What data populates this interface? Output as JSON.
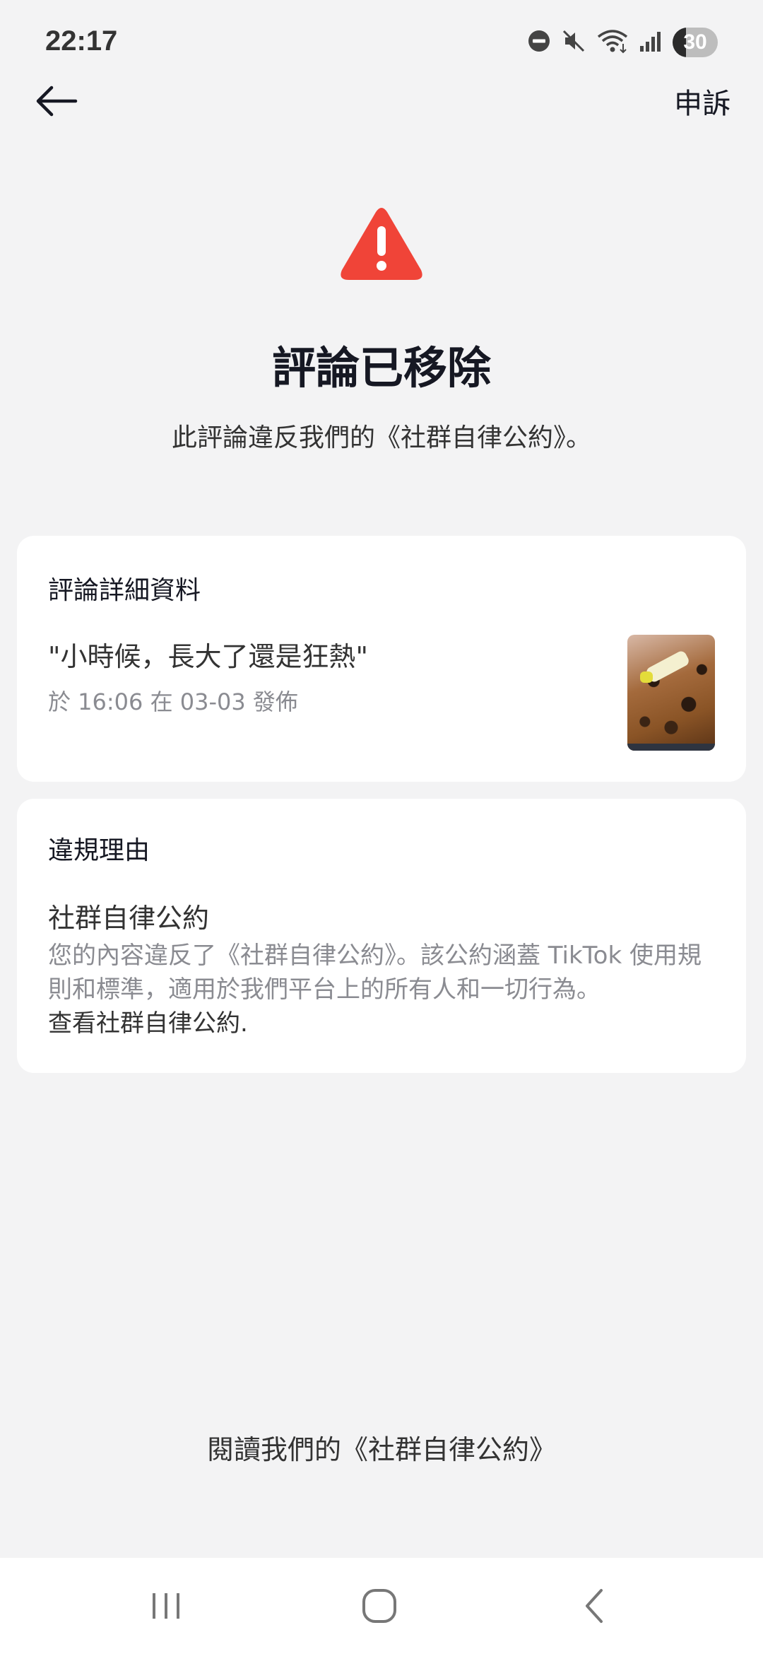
{
  "status_bar": {
    "time": "22:17",
    "battery_level": "30",
    "icons": [
      "do-not-disturb-icon",
      "mute-icon",
      "wifi-icon",
      "signal-icon",
      "battery-icon"
    ]
  },
  "header": {
    "back_icon": "arrow-left-icon",
    "appeal_label": "申訴"
  },
  "notice": {
    "icon": "warning-triangle-icon",
    "accent_color": "#f04438",
    "title": "評論已移除",
    "subtitle": "此評論違反我們的《社群自律公約》。"
  },
  "comment_details": {
    "heading": "評論詳細資料",
    "comment_text": "\"小時候，長大了還是狂熱\"",
    "posted_meta": "於 16:06 在 03-03 發佈"
  },
  "violation": {
    "heading": "違規理由",
    "policy_name": "社群自律公約",
    "description": "您的內容違反了《社群自律公約》。該公約涵蓋 TikTok 使用規則和標準，適用於我們平台上的所有人和一切行為。",
    "link_text": "查看社群自律公約."
  },
  "footer": {
    "read_guidelines_label": "閱讀我們的《社群自律公約》"
  },
  "nav_bar": {
    "buttons": [
      "recent-apps-icon",
      "home-icon",
      "back-icon"
    ]
  }
}
